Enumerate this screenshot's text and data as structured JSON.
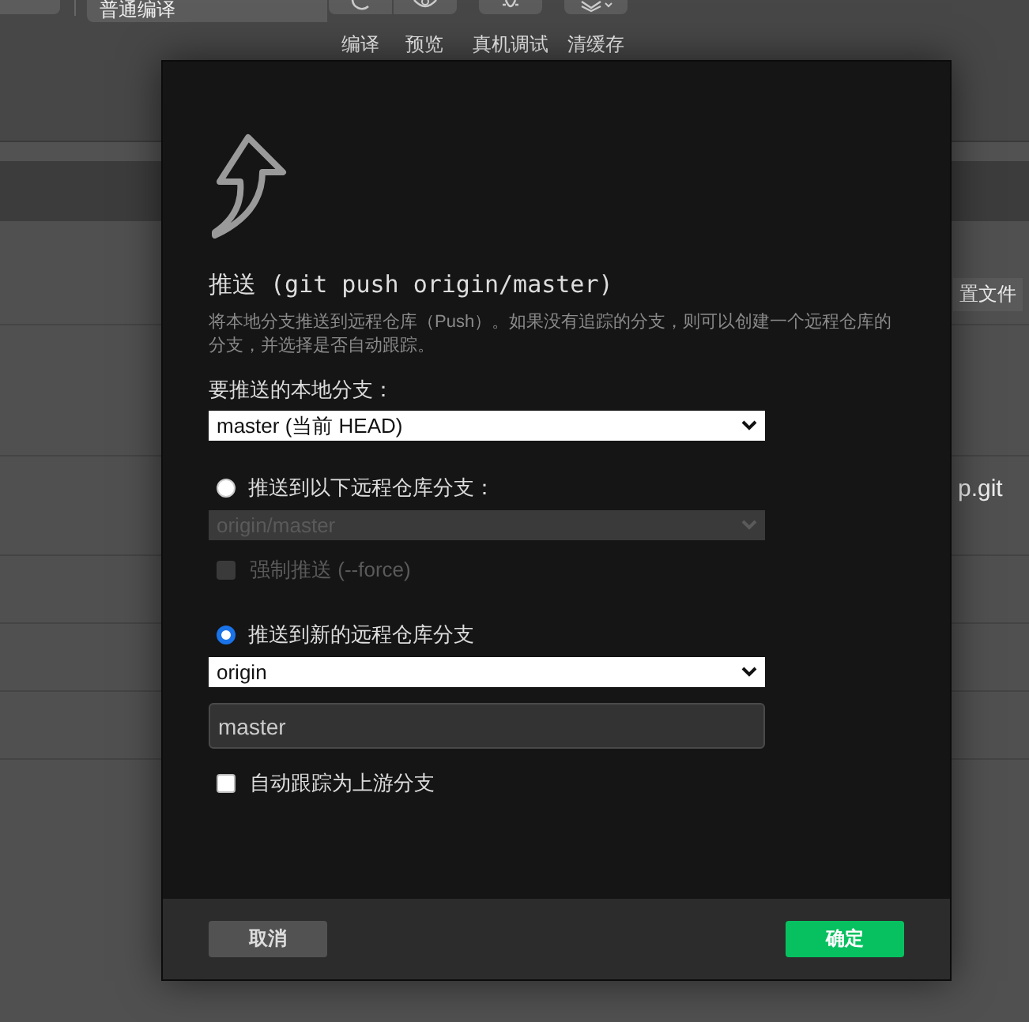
{
  "toolbar": {
    "mode_select": {
      "value": "普通编译"
    },
    "buttons": [
      {
        "label": "编译"
      },
      {
        "label": "预览"
      },
      {
        "label": "真机调试"
      },
      {
        "label": "清缓存"
      }
    ]
  },
  "background_texts": [
    "置文件",
    "p.git"
  ],
  "dialog": {
    "title": "推送 (git push origin/master)",
    "description": "将本地分支推送到远程仓库（Push）。如果没有追踪的分支，则可以创建一个远程仓库的分支，并选择是否自动跟踪。",
    "local_branch": {
      "label": "要推送的本地分支：",
      "value": "master (当前 HEAD)"
    },
    "options": [
      {
        "kind": "existing",
        "label": "推送到以下远程仓库分支：",
        "selected": false,
        "remote_branch": {
          "value": "origin/master",
          "disabled": true
        },
        "force": {
          "label": "强制推送 (--force)",
          "checked": false,
          "disabled": true
        }
      },
      {
        "kind": "new",
        "label": "推送到新的远程仓库分支",
        "selected": true,
        "remote": {
          "value": "origin"
        },
        "branch_name": {
          "value": "master"
        }
      }
    ],
    "auto_track": {
      "label": "自动跟踪为上游分支",
      "checked": false
    },
    "buttons": {
      "cancel": "取消",
      "confirm": "确定"
    }
  }
}
